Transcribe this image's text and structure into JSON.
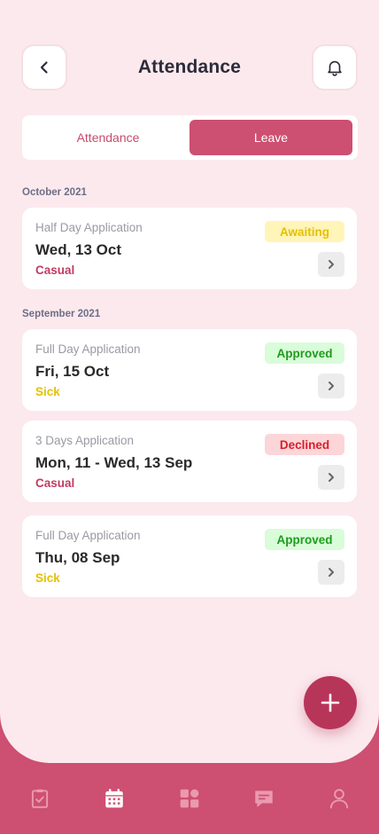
{
  "header": {
    "title": "Attendance",
    "back_icon": "chevron-left-icon",
    "bell_icon": "bell-icon"
  },
  "tabs": [
    {
      "label": "Attendance",
      "active": false
    },
    {
      "label": "Leave",
      "active": true
    }
  ],
  "groups": [
    {
      "month": "October 2021",
      "items": [
        {
          "kind": "Half Day Application",
          "date": "Wed, 13 Oct",
          "type": "Casual",
          "status": "Awaiting"
        }
      ]
    },
    {
      "month": "September 2021",
      "items": [
        {
          "kind": "Full Day Application",
          "date": "Fri, 15 Oct",
          "type": "Sick",
          "status": "Approved"
        },
        {
          "kind": "3 Days Application",
          "date": "Mon, 11 - Wed, 13 Sep",
          "type": "Casual",
          "status": "Declined"
        },
        {
          "kind": "Full Day Application",
          "date": "Thu, 08 Sep",
          "type": "Sick",
          "status": "Approved"
        }
      ]
    }
  ],
  "colors": {
    "accent": "#cd4f71",
    "background": "#fbe9ee",
    "casual": "#c23b62",
    "sick": "#e6c000",
    "awaiting_bg": "#fff5b8",
    "awaiting_fg": "#e6c000",
    "approved_bg": "#d9fcd9",
    "approved_fg": "#1f9b1f",
    "declined_bg": "#fcd5d8",
    "declined_fg": "#d81e2a"
  },
  "fab": {
    "icon": "plus-icon"
  },
  "bottom_nav": [
    {
      "icon": "clipboard-check-icon",
      "active": false
    },
    {
      "icon": "calendar-icon",
      "active": true
    },
    {
      "icon": "grid-icon",
      "active": false
    },
    {
      "icon": "chat-icon",
      "active": false
    },
    {
      "icon": "user-icon",
      "active": false
    }
  ]
}
